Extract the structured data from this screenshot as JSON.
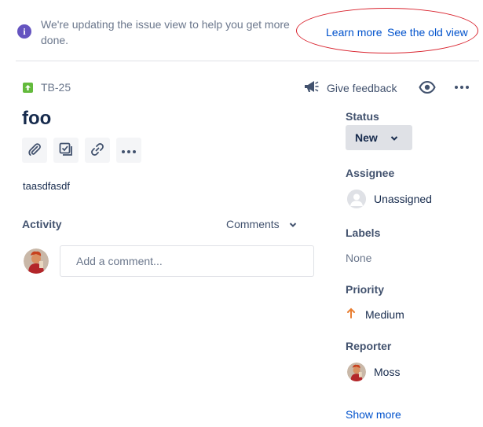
{
  "banner": {
    "message": "We're updating the issue view to help you get more done.",
    "learn_more": "Learn more",
    "old_view": "See the old view"
  },
  "issue": {
    "key": "TB-25",
    "title": "foo",
    "description": "taasdfasdf"
  },
  "header_actions": {
    "feedback_label": "Give feedback"
  },
  "activity": {
    "heading": "Activity",
    "filter": "Comments",
    "comment_placeholder": "Add a comment..."
  },
  "sidebar": {
    "status_label": "Status",
    "status_value": "New",
    "assignee_label": "Assignee",
    "assignee_value": "Unassigned",
    "labels_label": "Labels",
    "labels_value": "None",
    "priority_label": "Priority",
    "priority_value": "Medium",
    "reporter_label": "Reporter",
    "reporter_value": "Moss",
    "show_more": "Show more"
  },
  "colors": {
    "accent_link": "#0052cc",
    "info_icon": "#6554c0",
    "story_icon": "#63ba3c",
    "priority_medium": "#e97f33",
    "annotation_ring": "#d9232e"
  },
  "icons": [
    "info-icon",
    "story-type-icon",
    "megaphone-icon",
    "eye-icon",
    "more-icon",
    "attachment-icon",
    "checklist-icon",
    "link-icon",
    "chevron-down-icon",
    "arrow-up-icon",
    "user-icon"
  ]
}
